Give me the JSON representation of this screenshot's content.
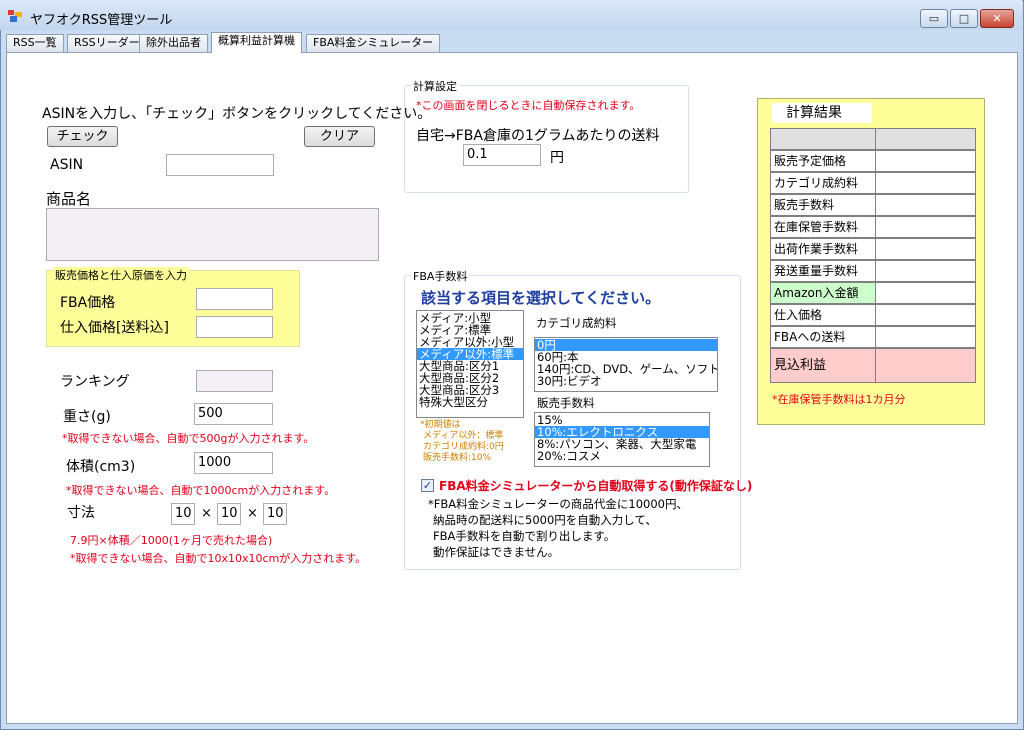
{
  "window": {
    "title": "ヤフオクRSS管理ツール",
    "min_glyph": "▭",
    "max_glyph": "□",
    "close_glyph": "✕"
  },
  "tabs": [
    {
      "label": "RSS一覧"
    },
    {
      "label": "RSSリーダー"
    },
    {
      "label": "除外出品者"
    },
    {
      "label": "概算利益計算機"
    },
    {
      "label": "FBA料金シミュレーター"
    }
  ],
  "active_tab": 3,
  "left": {
    "instruction": "ASINを入力し、「チェック」ボタンをクリックしてください。",
    "check_label": "チェック",
    "clear_label": "クリア",
    "asin_label": "ASIN",
    "asin_value": "",
    "product_name_label": "商品名",
    "product_name_value": "",
    "price_group_title": "販売価格と仕入原価を入力",
    "fba_price_label": "FBA価格",
    "fba_price_value": "",
    "purchase_price_label": "仕入価格[送料込]",
    "purchase_price_value": "",
    "ranking_label": "ランキング",
    "ranking_value": "",
    "weight_label": "重さ(g)",
    "weight_value": "500",
    "weight_note": "*取得できない場合、自動で500gが入力されます。",
    "volume_label": "体積(cm3)",
    "volume_value": "1000",
    "volume_note": "*取得できない場合、自動で1000cmが入力されます。",
    "dims_label": "寸法",
    "dim1": "10",
    "dim2": "10",
    "dim3": "10",
    "times1": "×",
    "times2": "×",
    "storage_note": "7.9円×体積／1000(1ヶ月で売れた場合)",
    "dims_note": "*取得できない場合、自動で10x10x10cmが入力されます。"
  },
  "calc_settings": {
    "title": "計算設定",
    "autosave_note": "*この画面を閉じるときに自動保存されます。",
    "shipping_label": "自宅→FBA倉庫の1グラムあたりの送料",
    "shipping_value": "0.1",
    "yen": "円"
  },
  "fba_fees": {
    "title": "FBA手数料",
    "heading": "該当する項目を選択してください。",
    "size_items": [
      {
        "label": "メディア:小型",
        "selected": false
      },
      {
        "label": "メディア:標準",
        "selected": false
      },
      {
        "label": "メディア以外:小型",
        "selected": false
      },
      {
        "label": "メディア以外:標準",
        "selected": true
      },
      {
        "label": "大型商品:区分1",
        "selected": false
      },
      {
        "label": "大型商品:区分2",
        "selected": false
      },
      {
        "label": "大型商品:区分3",
        "selected": false
      },
      {
        "label": "特殊大型区分",
        "selected": false
      }
    ],
    "category_fee_label": "カテゴリ成約料",
    "category_items": [
      {
        "label": "0円",
        "selected": true
      },
      {
        "label": "60円:本",
        "selected": false
      },
      {
        "label": "140円:CD、DVD、ゲーム、ソフト",
        "selected": false
      },
      {
        "label": "30円:ビデオ",
        "selected": false
      }
    ],
    "sales_fee_label": "販売手数料",
    "sales_items": [
      {
        "label": "15%",
        "selected": false
      },
      {
        "label": "10%:エレクトロニクス",
        "selected": true
      },
      {
        "label": "8%:パソコン、楽器、大型家電",
        "selected": false
      },
      {
        "label": "20%:コスメ",
        "selected": false
      }
    ],
    "default_note_1": "*初期値は",
    "default_note_2": "メディア以外：標準",
    "default_note_3": "カテゴリ成約料:0円",
    "default_note_4": "販売手数料:10%",
    "auto_fetch_checked": true,
    "check_glyph": "✓",
    "auto_fetch_label": "FBA料金シミュレーターから自動取得する(動作保証なし)",
    "auto_note_1": "*FBA料金シミュレーターの商品代金に10000円、",
    "auto_note_2": "納品時の配送料に5000円を自動入力して、",
    "auto_note_3": "FBA手数料を自動で割り出します。",
    "auto_note_4": "動作保証はできません。"
  },
  "results": {
    "title": "計算結果",
    "rows": [
      {
        "label": "販売予定価格",
        "value": ""
      },
      {
        "label": "カテゴリ成約料",
        "value": ""
      },
      {
        "label": "販売手数料",
        "value": ""
      },
      {
        "label": "在庫保管手数料",
        "value": ""
      },
      {
        "label": "出荷作業手数料",
        "value": ""
      },
      {
        "label": "発送重量手数料",
        "value": ""
      },
      {
        "label": "Amazon入金額",
        "value": ""
      },
      {
        "label": "仕入価格",
        "value": ""
      },
      {
        "label": "FBAへの送料",
        "value": ""
      }
    ],
    "profit_label": "見込利益",
    "profit_value": "",
    "footnote": "*在庫保管手数料は1カ月分"
  },
  "colors": {
    "red_text": "#e0001a",
    "heading_blue": "#1f3fa0",
    "yellow_bg": "#ffff99",
    "selection": "#3399ff"
  }
}
